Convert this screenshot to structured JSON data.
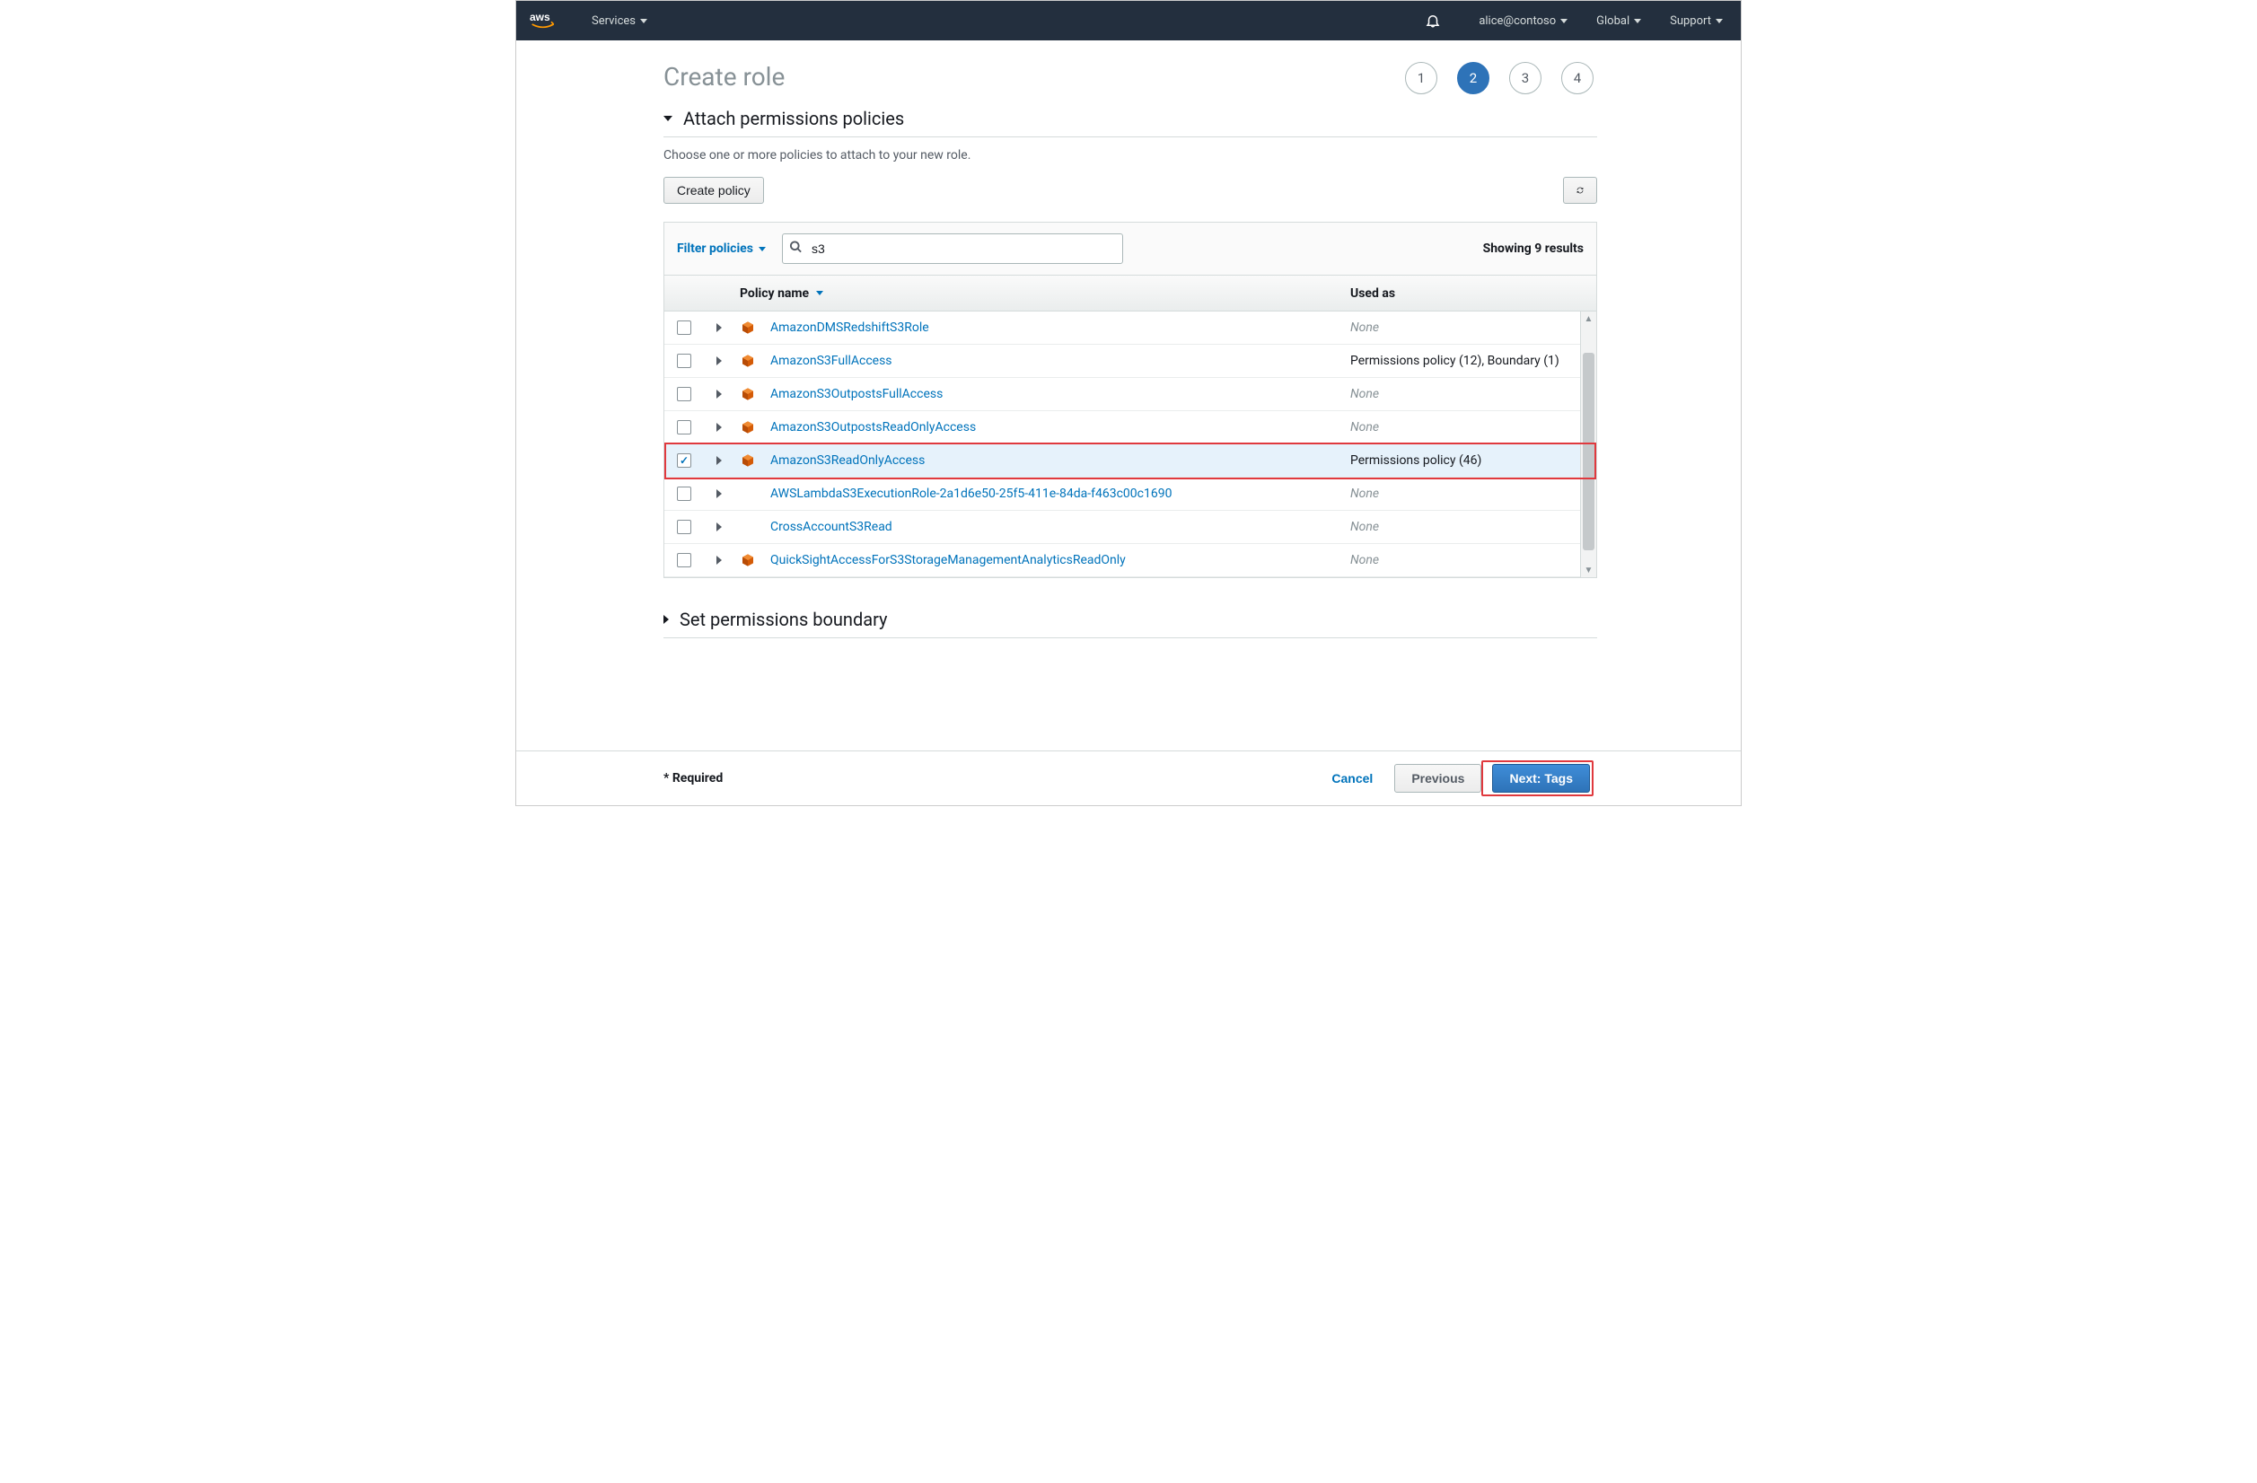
{
  "nav": {
    "services_label": "Services",
    "user_label": "alice@contoso",
    "region_label": "Global",
    "support_label": "Support"
  },
  "page": {
    "title": "Create role",
    "steps": [
      "1",
      "2",
      "3",
      "4"
    ],
    "active_step_index": 1
  },
  "attach": {
    "heading": "Attach permissions policies",
    "subhead": "Choose one or more policies to attach to your new role.",
    "create_policy_btn": "Create policy",
    "filter_label": "Filter policies",
    "search_value": "s3",
    "results_text": "Showing 9 results",
    "col_name": "Policy name",
    "col_used": "Used as"
  },
  "policies": [
    {
      "name": "AmazonDMSRedshiftS3Role",
      "managed": true,
      "checked": false,
      "used_as": "None",
      "none": true
    },
    {
      "name": "AmazonS3FullAccess",
      "managed": true,
      "checked": false,
      "used_as": "Permissions policy (12), Boundary (1)",
      "none": false
    },
    {
      "name": "AmazonS3OutpostsFullAccess",
      "managed": true,
      "checked": false,
      "used_as": "None",
      "none": true
    },
    {
      "name": "AmazonS3OutpostsReadOnlyAccess",
      "managed": true,
      "checked": false,
      "used_as": "None",
      "none": true
    },
    {
      "name": "AmazonS3ReadOnlyAccess",
      "managed": true,
      "checked": true,
      "used_as": "Permissions policy (46)",
      "none": false
    },
    {
      "name": "AWSLambdaS3ExecutionRole-2a1d6e50-25f5-411e-84da-f463c00c1690",
      "managed": false,
      "checked": false,
      "used_as": "None",
      "none": true
    },
    {
      "name": "CrossAccountS3Read",
      "managed": false,
      "checked": false,
      "used_as": "None",
      "none": true
    },
    {
      "name": "QuickSightAccessForS3StorageManagementAnalyticsReadOnly",
      "managed": true,
      "checked": false,
      "used_as": "None",
      "none": true
    }
  ],
  "boundary": {
    "heading": "Set permissions boundary"
  },
  "footer": {
    "required": "* Required",
    "cancel": "Cancel",
    "previous": "Previous",
    "next": "Next: Tags"
  }
}
